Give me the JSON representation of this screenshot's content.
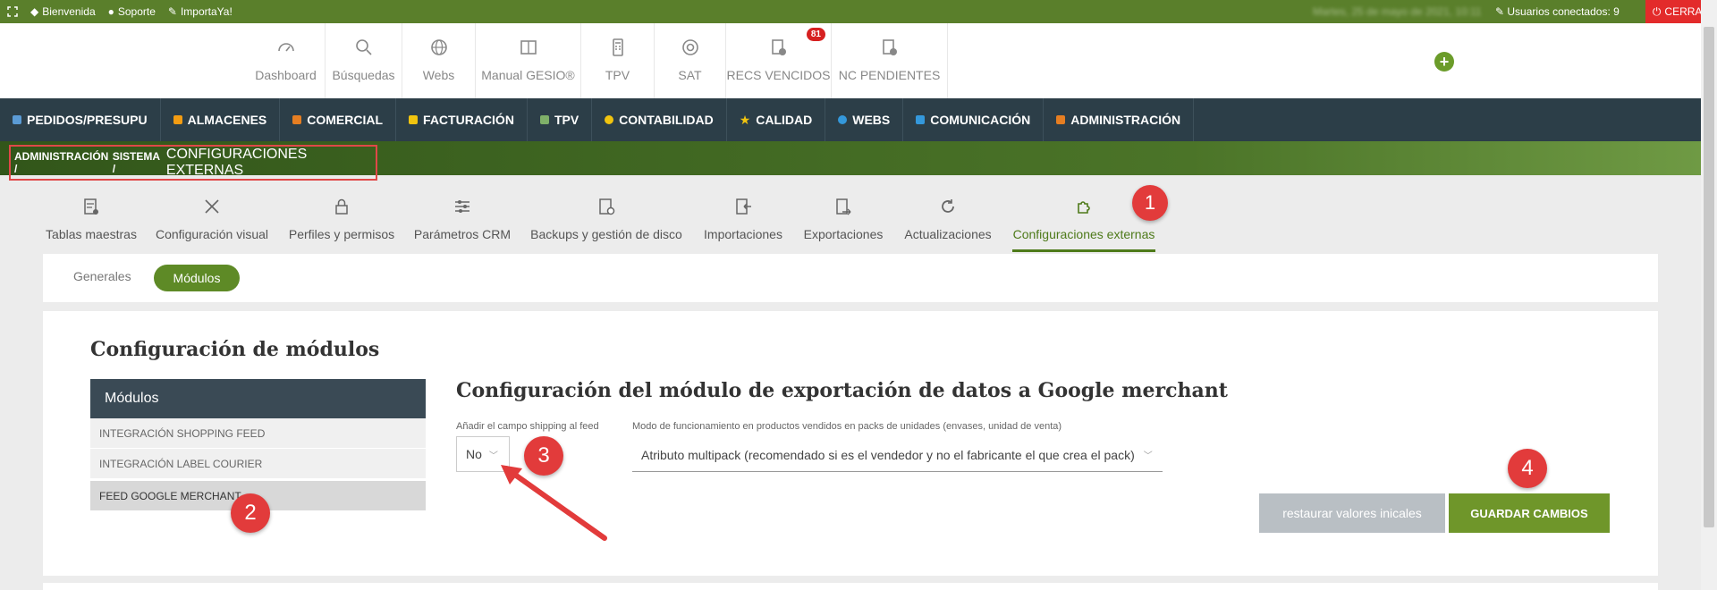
{
  "topbar": {
    "items": [
      "Bienvenida",
      "Soporte",
      "ImportaYa!"
    ],
    "date": "Martes, 25 de mayo de 2021, 10:11",
    "users": "Usuarios conectados: 9",
    "close": "CERRAR"
  },
  "toolbar": {
    "items": [
      {
        "label": "Dashboard",
        "icon": "gauge-icon"
      },
      {
        "label": "Búsquedas",
        "icon": "search-icon"
      },
      {
        "label": "Webs",
        "icon": "globe-icon"
      },
      {
        "label": "Manual GESIO®",
        "icon": "book-icon"
      },
      {
        "label": "TPV",
        "icon": "pos-terminal-icon"
      },
      {
        "label": "SAT",
        "icon": "lifebuoy-icon"
      },
      {
        "label": "RECS VENCIDOS",
        "icon": "receipt-icon",
        "badge": "81"
      },
      {
        "label": "NC PENDIENTES",
        "icon": "receipt-icon"
      }
    ],
    "add_icon": "+"
  },
  "mainnav": [
    {
      "label": "PEDIDOS/PRESUPU",
      "color": "#5b9bd5"
    },
    {
      "label": "ALMACENES",
      "color": "#f39c12"
    },
    {
      "label": "COMERCIAL",
      "color": "#e67e22"
    },
    {
      "label": "FACTURACIÓN",
      "color": "#f1c40f"
    },
    {
      "label": "TPV",
      "color": "#7fb069"
    },
    {
      "label": "CONTABILIDAD",
      "color": "#f1c40f"
    },
    {
      "label": "CALIDAD",
      "color": "#f1c40f"
    },
    {
      "label": "WEBS",
      "color": "#3498db"
    },
    {
      "label": "COMUNICACIÓN",
      "color": "#3498db"
    },
    {
      "label": "ADMINISTRACIÓN",
      "color": "#e67e22"
    }
  ],
  "breadcrumb": {
    "part1": "ADMINISTRACIÓN /",
    "part2": "SISTEMA /",
    "current": "CONFIGURACIONES EXTERNAS"
  },
  "subtabs": [
    {
      "label": "Tablas maestras",
      "icon": "table-gear-icon"
    },
    {
      "label": "Configuración visual",
      "icon": "tools-icon"
    },
    {
      "label": "Perfiles y permisos",
      "icon": "lock-icon"
    },
    {
      "label": "Parámetros CRM",
      "icon": "sliders-icon"
    },
    {
      "label": "Backups y gestión de disco",
      "icon": "backup-icon"
    },
    {
      "label": "Importaciones",
      "icon": "import-icon"
    },
    {
      "label": "Exportaciones",
      "icon": "export-icon"
    },
    {
      "label": "Actualizaciones",
      "icon": "refresh-icon"
    },
    {
      "label": "Configuraciones externas",
      "icon": "puzzle-icon",
      "active": true
    }
  ],
  "pills": {
    "generales": "Generales",
    "modulos": "Módulos"
  },
  "config": {
    "title": "Configuración de módulos",
    "modules_header": "Módulos",
    "modules": [
      "INTEGRACIÓN SHOPPING FEED",
      "INTEGRACIÓN LABEL COURIER",
      "FEED GOOGLE MERCHANT"
    ],
    "module_title": "Configuración del módulo de exportación de datos a Google merchant",
    "shipping_label": "Añadir el campo shipping al feed",
    "shipping_value": "No",
    "mode_label": "Modo de funcionamiento en productos vendidos en packs de unidades (envases, unidad de venta)",
    "mode_value": "Atributo multipack (recomendado si es el vendedor y no el fabricante el que crea el pack)",
    "restore_label": "restaurar valores inicales",
    "save_label": "GUARDAR CAMBIOS"
  },
  "annotations": [
    "1",
    "2",
    "3",
    "4"
  ]
}
